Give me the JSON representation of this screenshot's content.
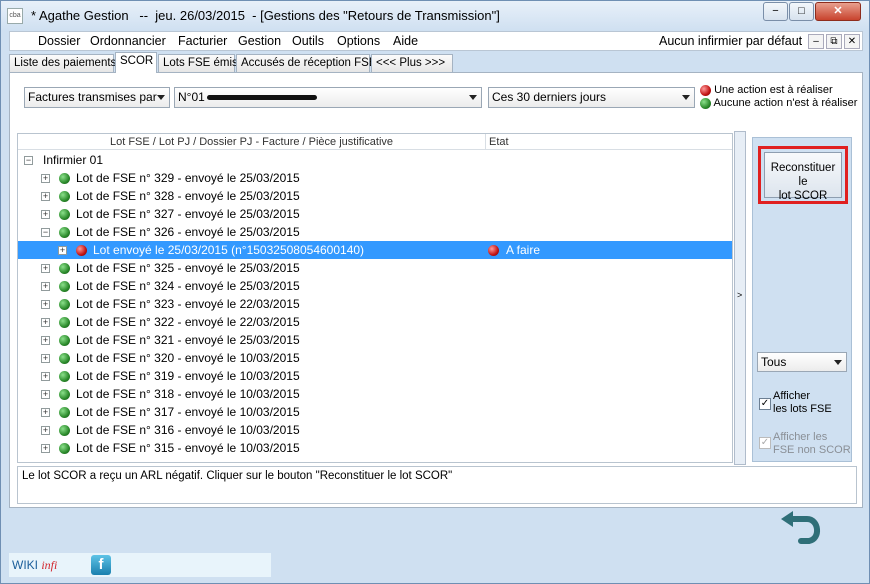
{
  "window": {
    "icon_text": "cba",
    "title": "* Agathe Gestion   --  jeu. 26/03/2015  - [Gestions des \"Retours de Transmission\"]",
    "minimize": "−",
    "maximize": "□",
    "close": "✕"
  },
  "menu": {
    "items": [
      "Dossier",
      "Ordonnancier",
      "Facturier",
      "Gestion",
      "Outils",
      "Options",
      "Aide"
    ],
    "right_text": "Aucun infirmier par défaut",
    "mdi_min": "–",
    "mdi_restore": "⧉",
    "mdi_close": "✕"
  },
  "tabs": [
    "Liste des paiements",
    "SCOR",
    "Lots FSE émis",
    "Accusés de réception FSE",
    "<<< Plus >>>"
  ],
  "filters": {
    "type": "Factures transmises par",
    "nurse_prefix": "N°01",
    "period": "Ces 30 derniers jours"
  },
  "legend": {
    "red": "Une action est à réaliser",
    "green": "Aucune action n'est à réaliser"
  },
  "tree": {
    "col1": "Lot FSE / Lot PJ / Dossier PJ - Facture / Pièce justificative",
    "col2": "Etat",
    "root": "Infirmier 01",
    "lots": [
      "Lot de FSE n° 329 - envoyé le 25/03/2015",
      "Lot de FSE n° 328 - envoyé le 25/03/2015",
      "Lot de FSE n° 327 - envoyé le 25/03/2015",
      "Lot de FSE n° 326 - envoyé le 25/03/2015",
      "Lot envoyé le 25/03/2015 (n°15032508054600140)",
      "Lot de FSE n° 325 - envoyé le 25/03/2015",
      "Lot de FSE n° 324 - envoyé le 25/03/2015",
      "Lot de FSE n° 323 - envoyé le 22/03/2015",
      "Lot de FSE n° 322 - envoyé le 22/03/2015",
      "Lot de FSE n° 321 - envoyé le 25/03/2015",
      "Lot de FSE n° 320 - envoyé le 10/03/2015",
      "Lot de FSE n° 319 - envoyé le 10/03/2015",
      "Lot de FSE n° 318 - envoyé le 10/03/2015",
      "Lot de FSE n° 317 - envoyé le 10/03/2015",
      "Lot de FSE n° 316 - envoyé le 10/03/2015",
      "Lot de FSE n° 315 - envoyé le 10/03/2015"
    ],
    "selected_state": "A faire"
  },
  "panel": {
    "splitter": ">",
    "rebuild_line1": "Reconstituer le",
    "rebuild_line2": "lot SCOR",
    "filter_value": "Tous",
    "show_lots_line1": "Afficher",
    "show_lots_line2": "les lots FSE",
    "show_nonscor_line1": "Afficher les",
    "show_nonscor_line2": "FSE non SCOR",
    "check": "✓"
  },
  "message": "Le lot SCOR a reçu un ARL négatif. Cliquer sur le bouton \"Reconstituer le lot SCOR\"",
  "status": {
    "wiki": "WIKI",
    "infi": "infi",
    "facebook": "f"
  },
  "colors": {
    "accent_red": "#e02020",
    "selection": "#3399ff"
  }
}
